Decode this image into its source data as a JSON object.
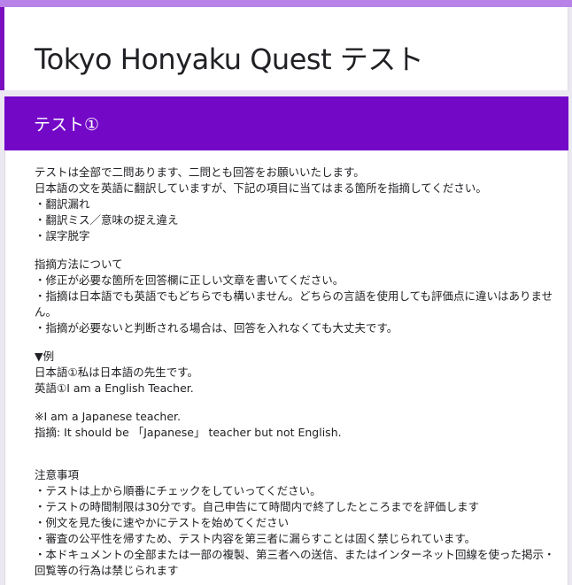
{
  "form": {
    "title": "Tokyo Honyaku Quest テスト",
    "section_title": "テスト①"
  },
  "description": {
    "intro": [
      "テストは全部で二問あります、二問とも回答をお願いいたします。",
      "日本語の文を英語に翻訳していますが、下記の項目に当てはまる箇所を指摘してください。",
      "・翻訳漏れ",
      "・翻訳ミス／意味の捉え違え",
      "・誤字脱字"
    ],
    "method": [
      "指摘方法について",
      "・修正が必要な箇所を回答欄に正しい文章を書いてください。",
      "・指摘は日本語でも英語でもどちらでも構いません。どちらの言語を使用しても評価点に違いはありません。",
      "・指摘が必要ないと判断される場合は、回答を入れなくても大丈夫です。"
    ],
    "example": [
      "▼例",
      "日本語①私は日本語の先生です。",
      "英語①I am a English Teacher."
    ],
    "answer": [
      "※I am a Japanese teacher.",
      "指摘: It should be 「Japanese」 teacher but not English."
    ],
    "notes": [
      "注意事項",
      "・テストは上から順番にチェックをしていってください。",
      "・テストの時間制限は30分です。自己申告にて時間内で終了したところまでを評価します",
      "・例文を見た後に速やかにテストを始めてください",
      "・審査の公平性を帰すため、テスト内容を第三者に漏らすことは固く禁じられています。",
      "・本ドキュメントの全部または一部の複製、第三者への送信、またはインターネット回線を使った掲示・回覧等の行為は禁じられます"
    ]
  },
  "colors": {
    "accent": "#7308c7",
    "top_bar": "#b982e8"
  }
}
